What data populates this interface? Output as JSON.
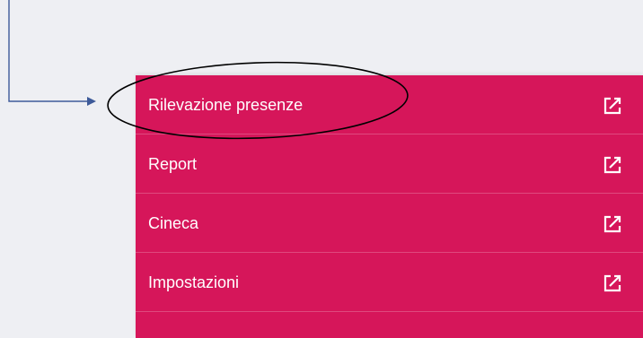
{
  "menu": {
    "items": [
      {
        "label": "Rilevazione presenze",
        "icon": "external-link-icon"
      },
      {
        "label": "Report",
        "icon": "external-link-icon"
      },
      {
        "label": "Cineca",
        "icon": "external-link-icon"
      },
      {
        "label": "Impostazioni",
        "icon": "external-link-icon"
      }
    ]
  },
  "colors": {
    "background": "#eeeff3",
    "menu_background": "#d6165a",
    "text": "#ffffff",
    "annotation_arrow": "#3d5a99",
    "annotation_ellipse": "#000000"
  }
}
